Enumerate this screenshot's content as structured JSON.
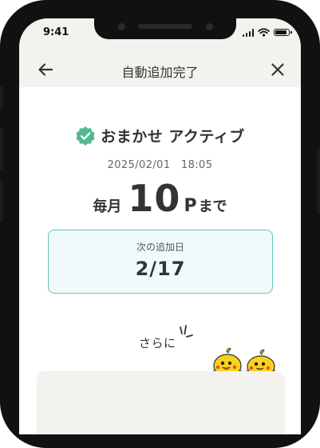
{
  "status_bar": {
    "time": "9:41"
  },
  "nav": {
    "title": "自動追加完了"
  },
  "status": {
    "label": "おまかせ アクティブ",
    "timestamp": "2025/02/01　18:05"
  },
  "amount": {
    "prefix": "毎月",
    "value": "10",
    "unit": "P",
    "suffix": "まで"
  },
  "next_card": {
    "label": "次の追加日",
    "date": "2/17"
  },
  "more": {
    "label": "さらに"
  },
  "colors": {
    "accent": "#66c4b7",
    "check_green": "#52b98c",
    "header_bg": "#f3f2ef"
  }
}
